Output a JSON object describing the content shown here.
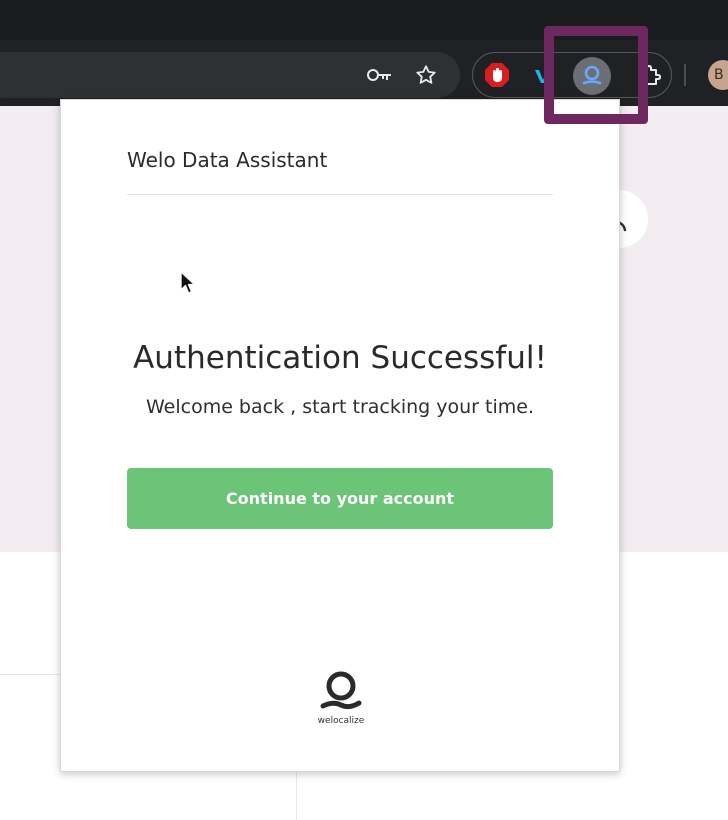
{
  "browser": {
    "profile_initial": "B",
    "colors": {
      "chrome_bg": "#202124",
      "highlight": "#6d2860",
      "extension_active": "#6aa8ff",
      "adblock_red": "#d81e1e",
      "vimeo_teal": "#1ab7ea"
    },
    "icons": [
      "key-icon",
      "star-icon",
      "adblock-icon",
      "vimeo-icon",
      "welo-extension-icon",
      "puzzle-icon"
    ]
  },
  "popup": {
    "title": "Welo Data Assistant",
    "headline": "Authentication Successful!",
    "message": "Welcome back , start tracking your time.",
    "continue_button": "Continue to your account",
    "logo_text": "welocalize",
    "accent_color": "#6bc477"
  }
}
